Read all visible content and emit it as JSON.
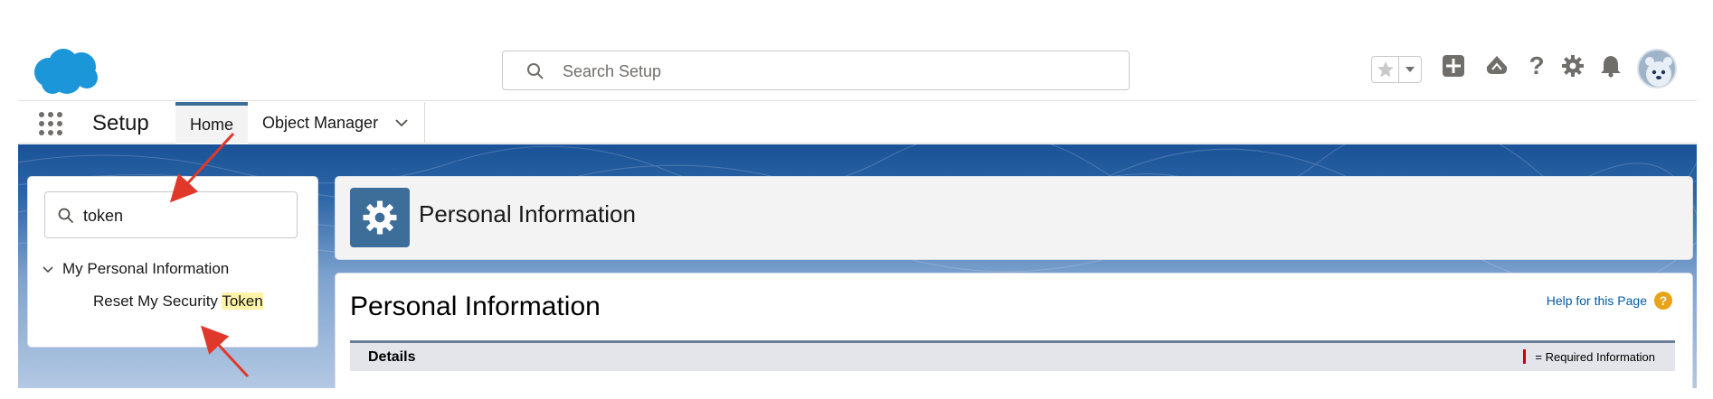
{
  "global_header": {
    "search_placeholder": "Search Setup",
    "icons": [
      "salesforce-cloud-logo",
      "search-icon",
      "star-icon",
      "dropdown-caret-icon",
      "add-icon",
      "trailhead-icon",
      "help-icon",
      "gear-icon",
      "bell-icon",
      "avatar"
    ]
  },
  "context_bar": {
    "app_name": "Setup",
    "tabs": [
      {
        "label": "Home",
        "active": true
      },
      {
        "label": "Object Manager",
        "has_menu": true
      }
    ]
  },
  "left_panel": {
    "quick_find_value": "token",
    "tree": {
      "parent_label": "My Personal Information",
      "child_label_prefix": "Reset My Security ",
      "child_label_highlight": "Token"
    }
  },
  "page_header": {
    "title": "Personal Information"
  },
  "content": {
    "title": "Personal Information",
    "help_link": "Help for this Page",
    "help_icon_glyph": "?",
    "section_title": "Details",
    "required_info": "= Required Information"
  },
  "colors": {
    "brand_blue": "#3c6e99",
    "banner_blue": "#1b5297",
    "highlight_yellow": "#fff3a7",
    "annotation_red": "#e0382b",
    "salesforce_cloud": "#1b96d8"
  }
}
